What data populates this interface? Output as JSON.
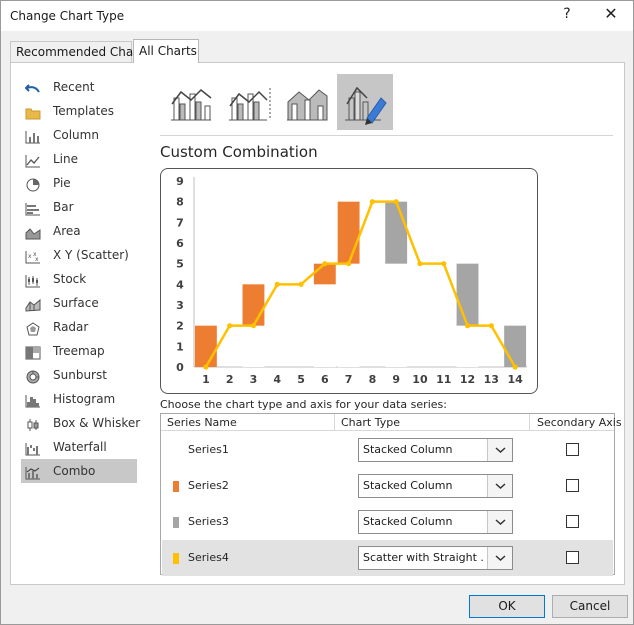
{
  "window": {
    "title": "Change Chart Type",
    "help_glyph": "?",
    "close_glyph": "✕"
  },
  "tabs": [
    {
      "label": "Recommended Charts",
      "selected": false
    },
    {
      "label": "All Charts",
      "selected": true
    }
  ],
  "sidebar": {
    "items": [
      {
        "label": "Recent",
        "icon": "undo-icon"
      },
      {
        "label": "Templates",
        "icon": "folder-icon"
      },
      {
        "label": "Column",
        "icon": "column-chart-icon"
      },
      {
        "label": "Line",
        "icon": "line-chart-icon"
      },
      {
        "label": "Pie",
        "icon": "pie-chart-icon"
      },
      {
        "label": "Bar",
        "icon": "bar-chart-icon"
      },
      {
        "label": "Area",
        "icon": "area-chart-icon"
      },
      {
        "label": "X Y (Scatter)",
        "icon": "scatter-chart-icon"
      },
      {
        "label": "Stock",
        "icon": "stock-chart-icon"
      },
      {
        "label": "Surface",
        "icon": "surface-chart-icon"
      },
      {
        "label": "Radar",
        "icon": "radar-chart-icon"
      },
      {
        "label": "Treemap",
        "icon": "treemap-chart-icon"
      },
      {
        "label": "Sunburst",
        "icon": "sunburst-chart-icon"
      },
      {
        "label": "Histogram",
        "icon": "histogram-chart-icon"
      },
      {
        "label": "Box & Whisker",
        "icon": "box-whisker-chart-icon"
      },
      {
        "label": "Waterfall",
        "icon": "waterfall-chart-icon"
      },
      {
        "label": "Combo",
        "icon": "combo-chart-icon",
        "selected": true
      }
    ]
  },
  "subtypes": [
    {
      "icon": "clustered-column-line-icon",
      "selected": false
    },
    {
      "icon": "clustered-column-line-secondary-icon",
      "selected": false
    },
    {
      "icon": "stacked-area-clustered-column-icon",
      "selected": false
    },
    {
      "icon": "custom-combination-icon",
      "selected": true
    }
  ],
  "combo": {
    "title": "Custom Combination",
    "instructions": "Choose the chart type and axis for your data series:"
  },
  "chart_data": {
    "type": "bar",
    "categories": [
      "1",
      "2",
      "3",
      "4",
      "5",
      "6",
      "7",
      "8",
      "9",
      "10",
      "11",
      "12",
      "13",
      "14"
    ],
    "ylim": [
      0,
      9
    ],
    "yticks": [
      "0",
      "1",
      "2",
      "3",
      "4",
      "5",
      "6",
      "7",
      "8",
      "9"
    ],
    "series": [
      {
        "name": "Series1",
        "values": [
          0,
          0,
          2,
          0,
          0,
          4,
          5,
          0,
          5,
          0,
          0,
          2,
          0,
          0
        ],
        "color": "#ffffff"
      },
      {
        "name": "Series2",
        "values": [
          2,
          0,
          2,
          0,
          0,
          1,
          3,
          0,
          0,
          0,
          0,
          0,
          0,
          0
        ],
        "color": "#ed7d31"
      },
      {
        "name": "Series3",
        "values": [
          0,
          0,
          0,
          0,
          0,
          0,
          0,
          0,
          3,
          0,
          0,
          3,
          0,
          2
        ],
        "color": "#a5a5a5"
      },
      {
        "name": "Series4",
        "type": "scatter-line",
        "color": "#ffc000",
        "points": [
          [
            1,
            0
          ],
          [
            2,
            2
          ],
          [
            3,
            2
          ],
          [
            4,
            4
          ],
          [
            5,
            4
          ],
          [
            6,
            5
          ],
          [
            7,
            5
          ],
          [
            8,
            8
          ],
          [
            9,
            8
          ],
          [
            10,
            5
          ],
          [
            11,
            5
          ],
          [
            12,
            2
          ],
          [
            13,
            2
          ],
          [
            14,
            0
          ]
        ]
      }
    ],
    "grid": false,
    "legend": "none"
  },
  "table": {
    "headers": {
      "name": "Series Name",
      "type": "Chart Type",
      "axis": "Secondary Axis"
    },
    "rows": [
      {
        "name": "Series1",
        "type": "Stacked Column",
        "color": "",
        "secondary": false,
        "selected": false
      },
      {
        "name": "Series2",
        "type": "Stacked Column",
        "color": "#ed7d31",
        "secondary": false,
        "selected": false
      },
      {
        "name": "Series3",
        "type": "Stacked Column",
        "color": "#a5a5a5",
        "secondary": false,
        "selected": false
      },
      {
        "name": "Series4",
        "type": "Scatter with Straight ...",
        "color": "#ffc000",
        "secondary": false,
        "selected": true
      }
    ]
  },
  "buttons": {
    "ok": "OK",
    "cancel": "Cancel"
  }
}
